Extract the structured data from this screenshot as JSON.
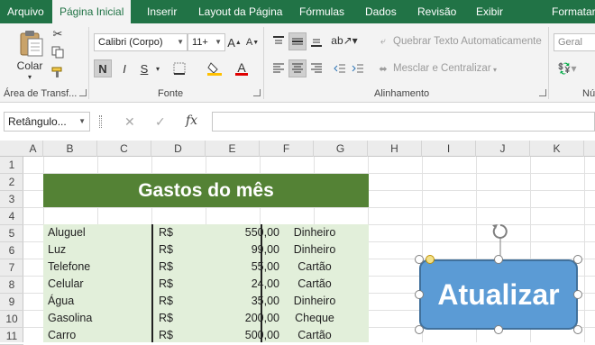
{
  "ribbon_tabs": [
    "Arquivo",
    "Página Inicial",
    "Inserir",
    "Layout da Página",
    "Fórmulas",
    "Dados",
    "Revisão",
    "Exibir",
    "Formatar"
  ],
  "active_tab": "Página Inicial",
  "clipboard": {
    "paste_label": "Colar",
    "group_label": "Área de Transf..."
  },
  "font": {
    "name": "Calibri (Corpo)",
    "size": "11+",
    "bold": "N",
    "italic": "I",
    "underline": "S",
    "group_label": "Fonte"
  },
  "alignment": {
    "wrap_text": "Quebrar Texto Automaticamente",
    "merge_center": "Mesclar e Centralizar",
    "group_label": "Alinhamento"
  },
  "number": {
    "format": "Geral",
    "group_label": "Nú"
  },
  "formula_bar": {
    "name_box": "Retângulo...",
    "cancel": "✕",
    "enter": "✓",
    "fx": "fx",
    "value": ""
  },
  "columns": [
    "A",
    "B",
    "C",
    "D",
    "E",
    "F",
    "G",
    "H",
    "I",
    "J",
    "K"
  ],
  "rows": [
    "1",
    "2",
    "3",
    "4",
    "5",
    "6",
    "7",
    "8",
    "9",
    "10",
    "11"
  ],
  "sheet": {
    "title": "Gastos do mês",
    "expenses": [
      {
        "name": "Aluguel",
        "currency": "R$",
        "value": "550,00",
        "payment": "Dinheiro"
      },
      {
        "name": "Luz",
        "currency": "R$",
        "value": "99,00",
        "payment": "Dinheiro"
      },
      {
        "name": "Telefone",
        "currency": "R$",
        "value": "55,00",
        "payment": "Cartão"
      },
      {
        "name": "Celular",
        "currency": "R$",
        "value": "24,00",
        "payment": "Cartão"
      },
      {
        "name": "Água",
        "currency": "R$",
        "value": "35,00",
        "payment": "Dinheiro"
      },
      {
        "name": "Gasolina",
        "currency": "R$",
        "value": "200,00",
        "payment": "Cheque"
      },
      {
        "name": "Carro",
        "currency": "R$",
        "value": "500,00",
        "payment": "Cartão"
      }
    ]
  },
  "shape": {
    "label": "Atualizar"
  },
  "colors": {
    "ribbon_green": "#217346",
    "title_fill": "#548235",
    "table_fill": "#e2efda",
    "shape_fill": "#5b9bd5"
  }
}
